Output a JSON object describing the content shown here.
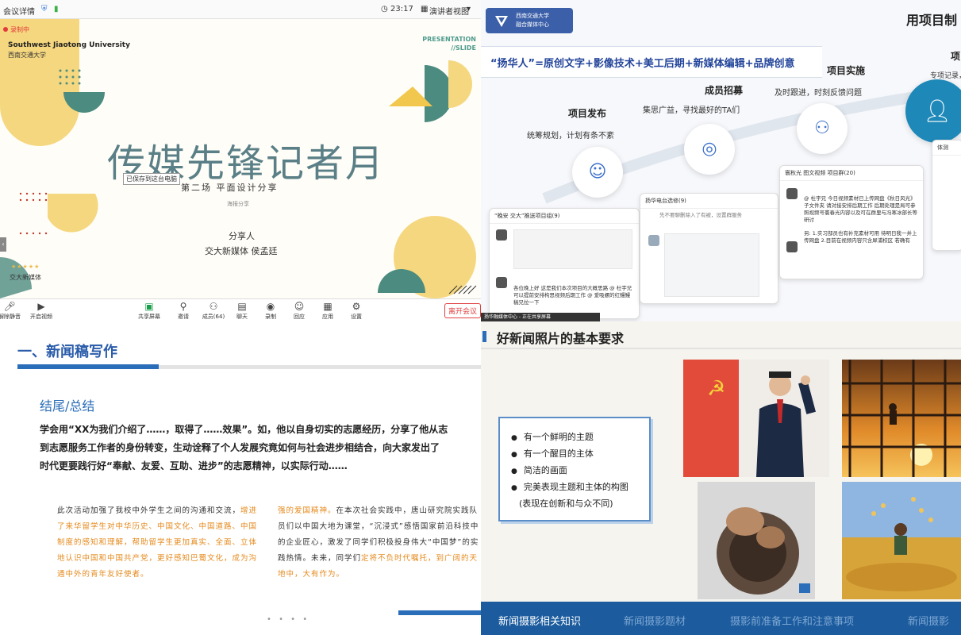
{
  "meeting": {
    "window_title": "会议详情",
    "clock": "23:17",
    "view_mode": "演讲者视图",
    "recording": "录制中",
    "saved_tooltip": "已保存到这台电脑",
    "slide": {
      "university_en": "Southwest Jiaotong University",
      "university_cn": "西南交通大学",
      "presentation_label": "PRESENTATION",
      "slide_label": "//SLIDE",
      "title": "传媒先锋记者月",
      "subtitle": "第二场 平面设计分享",
      "small_note": "海报分享",
      "sharer_label": "分享人",
      "sharer_name": "交大新媒体 侯孟廷",
      "logo_text": "交大新媒体"
    },
    "toolbar": {
      "mute": "解除静音",
      "video": "开启视频",
      "share": "共享屏幕",
      "invite": "邀请",
      "members": "成员(64)",
      "chat": "聊天",
      "record": "录制",
      "reaction": "回应",
      "apps": "应用",
      "settings": "设置",
      "leave": "离开会议"
    }
  },
  "project_slide": {
    "badge_line1": "西南交通大学",
    "badge_line2": "融合媒体中心",
    "title": "用项目制",
    "formula": "“扬华人”=原创文字+影像技术+美工后期+新媒体编辑+品牌创意",
    "steps": [
      {
        "heading": "项目发布",
        "desc": "统筹规划，计划有条不紊"
      },
      {
        "heading": "成员招募",
        "desc": "集思广益，寻找最好的TA们"
      },
      {
        "heading": "项目实施",
        "desc": "及时跟进，时刻反馈问题"
      }
    ],
    "partial_heading": "项",
    "partial_desc": "专项记录，",
    "chats": [
      {
        "title": "“晚安 交大”推送项目组(9)",
        "msg": "各位晚上好 这是我们本次项目的大概思路 @ 杜宇兄可以提前安排构思视频后期工作 @ 爱吸螺的红鳗鳗 稿兄拉一下"
      },
      {
        "title": "扬华电台选修(9)",
        "msg": "先不要聊删除入了有被，设置群服务"
      },
      {
        "title": "寰秋光 图文视频 项目群(20)",
        "msg": "@ 杜宇兄 今日视频素材已上传网盘《秋日风光》子文件夹 请对接安排后期工作 后期处理是局可参照视频号寰春光内容以及可在群里与冯寒冰部长等研讨",
        "msg2": "另: 1.实习部员也有补充素材可用 待明日我一并上传网盘 2.目前在视频内容只含犀浦校区 若确有"
      },
      {
        "title": "体测",
        "msg": ""
      }
    ],
    "taskbar_label": "扬华融媒体中心 - 正在共享屏幕"
  },
  "news_slide": {
    "title": "一、新闻稿写作",
    "subtitle": "结尾/总结",
    "para_line1": "学会用“XX为我们介绍了……，取得了……效果”。如，他以自身切实的志愿经历，分享了他从志",
    "para_line2": "到志愿服务工作者的身份转变，生动诠释了个人发展究竟如何与社会进步相结合，向大家发出了",
    "para_line3": "时代更要践行好“奉献、友爱、互助、进步”的志愿精神，以实际行动……",
    "left_plain": "此次活动加强了我校中外学生之间的沟通和交流，",
    "left_highlight": "增进了来华留学生对中华历史、中国文化、中国道路、中国制度的感知和理解，帮助留学生更加真实、全面、立体地认识中国和中国共产党，更好感知巴蜀文化，成为沟通中外的青年友好使者。",
    "right_highlight1": "强的爱国精神。",
    "right_plain1": "在本次社会实践中，唐山研究院实践队员们以中国大地为课堂，“沉浸式”感悟国家前沿科技中的企业匠心，激发了同学们积极投身伟大“中国梦”的实践热情。未来，同学们",
    "right_highlight2": "定将不负时代嘱托，到广阔的天地中，大有作为。",
    "pager": "• • • •"
  },
  "photo_slide": {
    "title": "好新闻照片的基本要求",
    "requirements": [
      "有一个鲜明的主题",
      "有一个醒目的主体",
      "简洁的画面",
      "完美表现主题和主体的构图"
    ],
    "requirement_note": "(表现在创新和与众不同)",
    "nav": [
      "新闻摄影相关知识",
      "新闻摄影题材",
      "摄影前准备工作和注意事项",
      "新闻摄影"
    ],
    "accent": "#1c5c9e"
  }
}
